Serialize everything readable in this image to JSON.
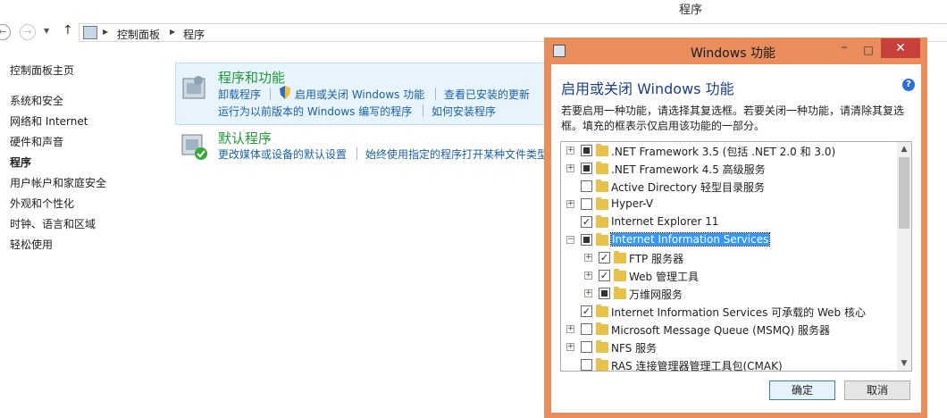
{
  "window": {
    "title": "程序"
  },
  "address": {
    "crumbs": [
      "控制面板",
      "程序"
    ]
  },
  "leftnav": {
    "items": [
      {
        "label": "控制面板主页",
        "bold": false
      },
      {
        "label": "系统和安全",
        "bold": false
      },
      {
        "label": "网络和 Internet",
        "bold": false
      },
      {
        "label": "硬件和声音",
        "bold": false
      },
      {
        "label": "程序",
        "bold": true
      },
      {
        "label": "用户帐户和家庭安全",
        "bold": false
      },
      {
        "label": "外观和个性化",
        "bold": false
      },
      {
        "label": "时钟、语言和区域",
        "bold": false
      },
      {
        "label": "轻松使用",
        "bold": false
      }
    ]
  },
  "main": {
    "section1": {
      "title": "程序和功能",
      "links": [
        "卸载程序",
        "启用或关闭 Windows 功能",
        "查看已安装的更新",
        "运行为以前版本的 Windows 编写的程序",
        "如何安装程序"
      ]
    },
    "section2": {
      "title": "默认程序",
      "links": [
        "更改媒体或设备的默认设置",
        "始终使用指定的程序打开某种文件类型"
      ]
    }
  },
  "dialog": {
    "title": "Windows 功能",
    "heading": "启用或关闭 Windows 功能",
    "description": "若要启用一种功能，请选择其复选框。若要关闭一种功能，请清除其复选框。填充的框表示仅启用该功能的一部分。",
    "features": [
      {
        "label": ".NET Framework 3.5 (包括 .NET 2.0 和 3.0)",
        "state": "partial",
        "expander": "+",
        "level": 0
      },
      {
        "label": ".NET Framework 4.5 高级服务",
        "state": "partial",
        "expander": "+",
        "level": 0
      },
      {
        "label": "Active Directory 轻型目录服务",
        "state": "unchecked",
        "expander": "",
        "level": 0
      },
      {
        "label": "Hyper-V",
        "state": "unchecked",
        "expander": "+",
        "level": 0
      },
      {
        "label": "Internet Explorer 11",
        "state": "checked",
        "expander": "",
        "level": 0
      },
      {
        "label": "Internet Information Services",
        "state": "partial",
        "expander": "−",
        "level": 0,
        "selected": true
      },
      {
        "label": "FTP 服务器",
        "state": "checked",
        "expander": "+",
        "level": 1
      },
      {
        "label": "Web 管理工具",
        "state": "checked",
        "expander": "+",
        "level": 1
      },
      {
        "label": "万维网服务",
        "state": "partial",
        "expander": "+",
        "level": 1
      },
      {
        "label": "Internet Information Services 可承载的 Web 核心",
        "state": "checked",
        "expander": "",
        "level": 0
      },
      {
        "label": "Microsoft Message Queue (MSMQ) 服务器",
        "state": "unchecked",
        "expander": "+",
        "level": 0
      },
      {
        "label": "NFS 服务",
        "state": "unchecked",
        "expander": "+",
        "level": 0
      },
      {
        "label": "RAS 连接管理器管理工具包(CMAK)",
        "state": "unchecked",
        "expander": "",
        "level": 0
      }
    ],
    "ok_label": "确定",
    "cancel_label": "取消"
  },
  "colors": {
    "accent_title": "#1f9b37",
    "link": "#1b5fa8",
    "dialog_frame": "#e98d5c",
    "close": "#c7403a"
  }
}
